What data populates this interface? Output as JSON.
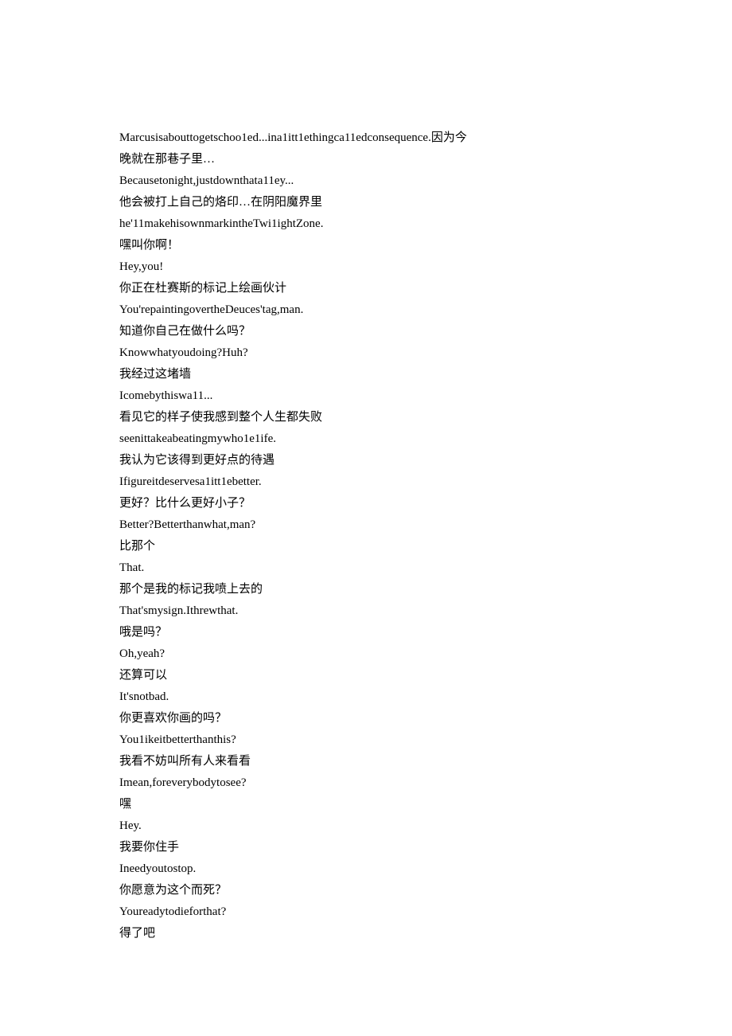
{
  "lines": [
    "Marcusisabouttogetschoo1ed...ina1itt1ethingca11edconsequence.因为今",
    "晚就在那巷子里…",
    "Becausetonight,justdownthata11ey...",
    "他会被打上自己的烙印…在阴阳魔界里",
    "he'11makehisownmarkintheTwi1ightZone.",
    "嘿叫你啊！",
    "Hey,you!",
    "你正在杜赛斯的标记上绘画伙计",
    "You'repaintingovertheDeuces'tag,man.",
    "知道你自己在做什么吗？",
    "Knowwhatyoudoing?Huh?",
    "我经过这堵墙",
    "Icomebythiswa11...",
    "看见它的样子使我感到整个人生都失败",
    "seenittakeabeatingmywho1e1ife.",
    "我认为它该得到更好点的待遇",
    "Ifigureitdeservesa1itt1ebetter.",
    "更好？比什么更好小子？",
    "Better?Betterthanwhat,man?",
    "比那个",
    "That.",
    "那个是我的标记我喷上去的",
    "That'smysign.Ithrewthat.",
    "哦是吗？",
    "Oh,yeah?",
    "还算可以",
    "It'snotbad.",
    "你更喜欢你画的吗？",
    "You1ikeitbetterthanthis?",
    "我看不妨叫所有人来看看",
    "Imean,foreverybodytosee?",
    "嘿",
    "Hey.",
    "我要你住手",
    "Ineedyoutostop.",
    "你愿意为这个而死？",
    "Youreadytodieforthat?",
    "得了吧"
  ]
}
